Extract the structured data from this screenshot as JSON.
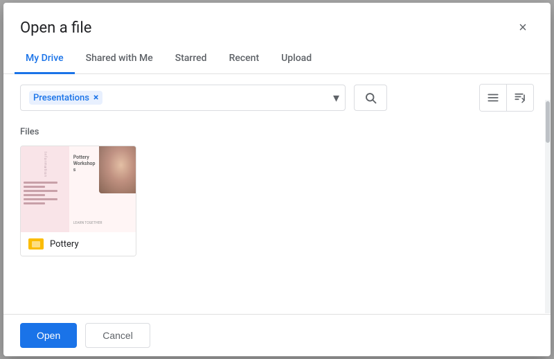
{
  "dialog": {
    "title": "Open a file",
    "close_label": "×"
  },
  "tabs": [
    {
      "id": "my-drive",
      "label": "My Drive",
      "active": true
    },
    {
      "id": "shared-with-me",
      "label": "Shared with Me",
      "active": false
    },
    {
      "id": "starred",
      "label": "Starred",
      "active": false
    },
    {
      "id": "recent",
      "label": "Recent",
      "active": false
    },
    {
      "id": "upload",
      "label": "Upload",
      "active": false
    }
  ],
  "filter": {
    "chip_label": "Presentations",
    "chip_remove": "×",
    "arrow": "▾"
  },
  "toolbar": {
    "search_tooltip": "Search",
    "list_view_tooltip": "List view",
    "sort_tooltip": "Sort"
  },
  "content": {
    "section_label": "Files",
    "files": [
      {
        "id": "pottery",
        "name": "Pottery",
        "type": "slides",
        "thumb_title": "Pottery Workshops",
        "thumb_sub": "LEARN TOGETHER"
      }
    ]
  },
  "footer": {
    "open_label": "Open",
    "cancel_label": "Cancel"
  },
  "icons": {
    "search": "🔍",
    "list": "☰",
    "sort": "A↕Z"
  }
}
